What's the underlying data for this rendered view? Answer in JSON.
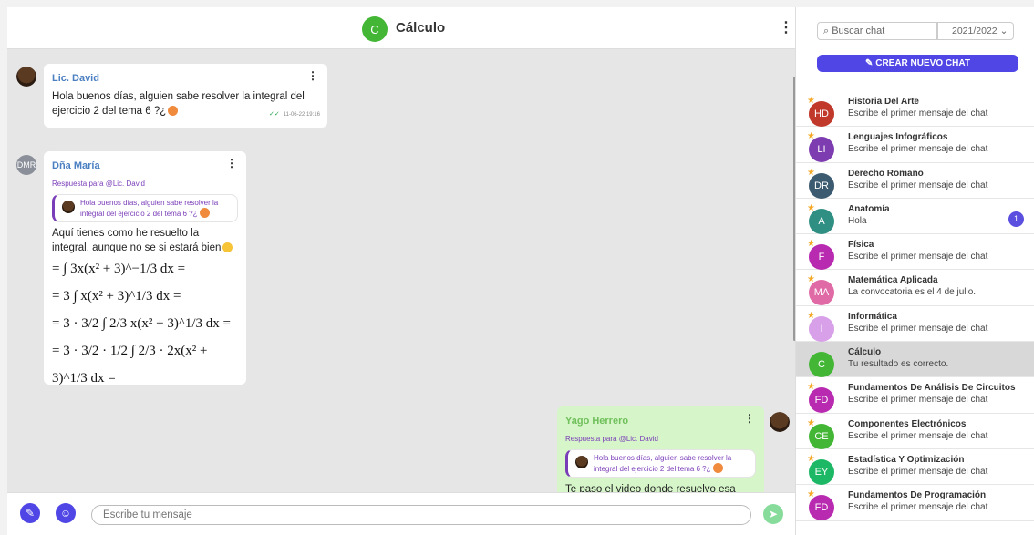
{
  "header": {
    "avatar_letter": "C",
    "title": "Cálculo",
    "menu_icon": "⋮"
  },
  "messages": {
    "m1": {
      "sender": "Lic. David",
      "text": "Hola buenos días, alguien sabe resolver la integral del ejercicio 2 del tema 6 ?¿",
      "time": "11-06-22 19:16",
      "ticks": "✓✓"
    },
    "m2": {
      "avatar": "DMR",
      "sender": "Dña María",
      "reply_label": "Respuesta para @Lic. David",
      "quote": "Hola buenos días, alguien sabe resolver la integral del ejercicio 2 del tema 6 ?¿",
      "text": "Aquí tienes como he resuelto la integral, aunque no se si estará bien",
      "math": [
        "= ∫ 3x(x² + 3)^−1/3 dx =",
        "= 3 ∫ x(x² + 3)^1/3 dx =",
        "= 3 · 3/2 ∫ 2/3 x(x² + 3)^1/3 dx =",
        "= 3 · 3/2 · 1/2 ∫ 2/3 · 2x(x² + 3)^1/3 dx ="
      ]
    },
    "m3": {
      "sender": "Yago Herrero",
      "reply_label": "Respuesta para @Lic. David",
      "quote": "Hola buenos días, alguien sabe resolver la integral del ejercicio 2 del tema 6 ?¿",
      "text": "Te paso el video donde resuelvo esa misma integral"
    }
  },
  "input": {
    "placeholder": "Escribe tu mensaje"
  },
  "sidebar": {
    "search_placeholder": "Buscar chat",
    "year": "2021/2022",
    "create_label": "CREAR NUEVO CHAT",
    "chats": [
      {
        "initials": "HD",
        "title": "Historia Del Arte",
        "sub": "Escribe el primer mensaje del chat",
        "color": "#c0392b"
      },
      {
        "initials": "LI",
        "title": "Lenguajes Infográficos",
        "sub": "Escribe el primer mensaje del chat",
        "color": "#7d3cb0"
      },
      {
        "initials": "DR",
        "title": "Derecho Romano",
        "sub": "Escribe el primer mensaje del chat",
        "color": "#3c5a70"
      },
      {
        "initials": "A",
        "title": "Anatomía",
        "sub": "Hola",
        "color": "#2f8f83",
        "badge": "1"
      },
      {
        "initials": "F",
        "title": "Física",
        "sub": "Escribe el primer mensaje del chat",
        "color": "#b82ab0"
      },
      {
        "initials": "MA",
        "title": "Matemática Aplicada",
        "sub": "La convocatoria es el 4 de julio.",
        "color": "#e06aa6"
      },
      {
        "initials": "I",
        "title": "Informática",
        "sub": "Escribe el primer mensaje del chat",
        "color": "#d7a0e8"
      },
      {
        "initials": "C",
        "title": "Cálculo",
        "sub": "Tu resultado es correcto.",
        "color": "#43b636"
      },
      {
        "initials": "FD",
        "title": "Fundamentos De Análisis De Circuitos",
        "sub": "Escribe el primer mensaje del chat",
        "color": "#b82ab0"
      },
      {
        "initials": "CE",
        "title": "Componentes Electrónicos",
        "sub": "Escribe el primer mensaje del chat",
        "color": "#43b636"
      },
      {
        "initials": "EY",
        "title": "Estadística Y Optimización",
        "sub": "Escribe el primer mensaje del chat",
        "color": "#1db865"
      },
      {
        "initials": "FD",
        "title": "Fundamentos De Programación",
        "sub": "Escribe el primer mensaje del chat",
        "color": "#b82ab0"
      }
    ]
  }
}
